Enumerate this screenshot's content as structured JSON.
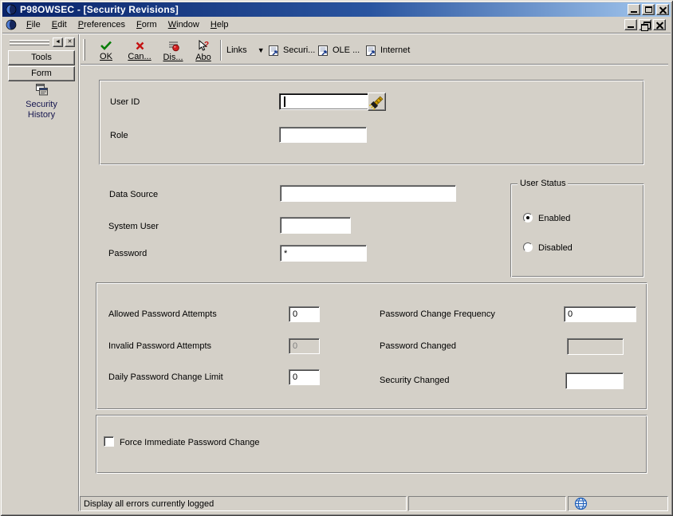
{
  "window": {
    "title": "P98OWSEC - [Security Revisions]"
  },
  "menu": {
    "items": [
      "File",
      "Edit",
      "Preferences",
      "Form",
      "Window",
      "Help"
    ]
  },
  "toolbar": {
    "ok_label": "OK",
    "cancel_label": "Can...",
    "display_errors_label": "Dis...",
    "about_label": "Abo",
    "links_label": "Links",
    "security_exit_label": "Securi...",
    "ole_exit_label": "OLE ...",
    "internet_exit_label": "Internet"
  },
  "sidebar": {
    "tools_tab": "Tools",
    "form_tab": "Form",
    "exits": [
      {
        "label": "Security History"
      }
    ]
  },
  "form": {
    "user_id": {
      "label": "User ID",
      "value": "",
      "focused": true
    },
    "role": {
      "label": "Role",
      "value": ""
    },
    "data_source": {
      "label": "Data Source",
      "value": ""
    },
    "system_user": {
      "label": "System User",
      "value": ""
    },
    "password": {
      "label": "Password",
      "value": "*"
    },
    "user_status": {
      "legend": "User Status",
      "enabled": {
        "label": "Enabled",
        "selected": true
      },
      "disabled": {
        "label": "Disabled",
        "selected": false
      }
    },
    "allowed_password_attempts": {
      "label": "Allowed Password Attempts",
      "value": "0",
      "disabled": false
    },
    "invalid_password_attempts": {
      "label": "Invalid Password Attempts",
      "value": "0",
      "disabled": true
    },
    "daily_password_change_limit": {
      "label": "Daily Password Change Limit",
      "value": "0",
      "disabled": false
    },
    "password_change_frequency": {
      "label": "Password Change Frequency",
      "value": "0",
      "disabled": false
    },
    "password_changed": {
      "label": "Password Changed",
      "value": "",
      "disabled": true
    },
    "security_changed": {
      "label": "Security Changed",
      "value": "",
      "disabled": false
    },
    "force_immediate_change": {
      "label": "Force Immediate Password Change",
      "checked": false
    }
  },
  "statusbar": {
    "message": "Display all errors currently logged"
  },
  "icons": {
    "app": "globe",
    "ok": "green-check",
    "cancel": "red-x",
    "display_errors": "red-dot-error-list",
    "about": "arrow-question",
    "links_dropdown": "▼",
    "row_exit": "form-page",
    "visual_assist": "flashlight",
    "security_history": "form-window",
    "status_globe": "globe",
    "sidebar_scroll": "◄",
    "sidebar_close": "✕",
    "minimize": "underscore-bar",
    "maximize": "box",
    "restore": "double-box",
    "close": "x"
  },
  "colors": {
    "titlebar_gradient_start": "#0a246a",
    "titlebar_gradient_end": "#a6caf0",
    "window_face": "#d4d0c8",
    "ok_check_green": "#077d07",
    "cancel_x_red": "#c41212",
    "field_white": "#ffffff"
  }
}
